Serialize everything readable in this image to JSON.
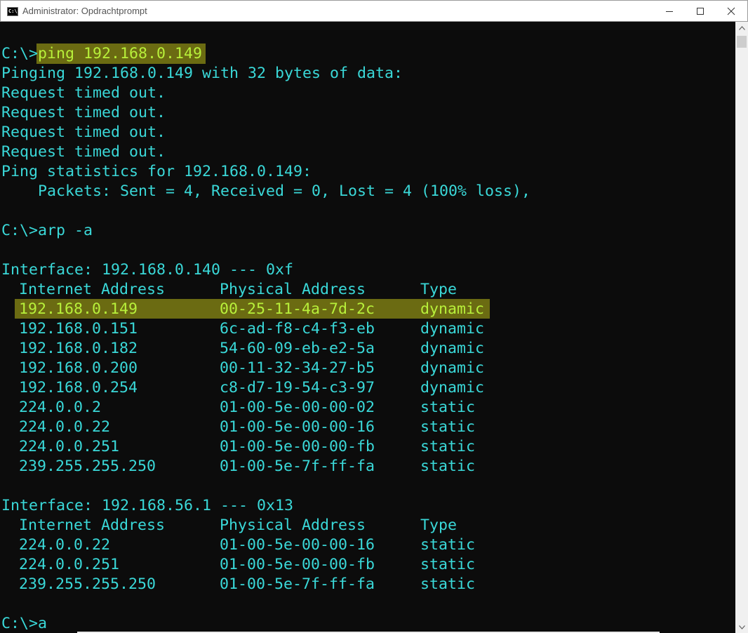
{
  "window": {
    "title": "Administrator: Opdrachtprompt",
    "icon": "cmd-icon",
    "icon_text": "C:\\"
  },
  "colors": {
    "text": "#3ad8d8",
    "highlight_bg": "#6b6b12",
    "highlight_text": "#b8f03a",
    "background": "#0c0c0c"
  },
  "console": {
    "ping_prompt": "C:\\>",
    "ping_command": "ping 192.168.0.149",
    "ping_output": [
      "Pinging 192.168.0.149 with 32 bytes of data:",
      "Request timed out.",
      "Request timed out.",
      "Request timed out.",
      "Request timed out.",
      "Ping statistics for 192.168.0.149:",
      "    Packets: Sent = 4, Received = 0, Lost = 4 (100% loss),"
    ],
    "arp_command": "C:\\>arp -a",
    "interfaces": [
      {
        "header": "Interface: 192.168.0.140 --- 0xf",
        "columns": [
          "Internet Address",
          "Physical Address",
          "Type"
        ],
        "rows": [
          {
            "ip": "192.168.0.149",
            "mac": "00-25-11-4a-7d-2c",
            "type": "dynamic"
          },
          {
            "ip": "192.168.0.151",
            "mac": "6c-ad-f8-c4-f3-eb",
            "type": "dynamic"
          },
          {
            "ip": "192.168.0.182",
            "mac": "54-60-09-eb-e2-5a",
            "type": "dynamic"
          },
          {
            "ip": "192.168.0.200",
            "mac": "00-11-32-34-27-b5",
            "type": "dynamic"
          },
          {
            "ip": "192.168.0.254",
            "mac": "c8-d7-19-54-c3-97",
            "type": "dynamic"
          },
          {
            "ip": "224.0.0.2",
            "mac": "01-00-5e-00-00-02",
            "type": "static"
          },
          {
            "ip": "224.0.0.22",
            "mac": "01-00-5e-00-00-16",
            "type": "static"
          },
          {
            "ip": "224.0.0.251",
            "mac": "01-00-5e-00-00-fb",
            "type": "static"
          },
          {
            "ip": "239.255.255.250",
            "mac": "01-00-5e-7f-ff-fa",
            "type": "static"
          }
        ]
      },
      {
        "header": "Interface: 192.168.56.1 --- 0x13",
        "columns": [
          "Internet Address",
          "Physical Address",
          "Type"
        ],
        "rows": [
          {
            "ip": "224.0.0.22",
            "mac": "01-00-5e-00-00-16",
            "type": "static"
          },
          {
            "ip": "224.0.0.251",
            "mac": "01-00-5e-00-00-fb",
            "type": "static"
          },
          {
            "ip": "239.255.255.250",
            "mac": "01-00-5e-7f-ff-fa",
            "type": "static"
          }
        ]
      }
    ],
    "current_input": "C:\\>a"
  },
  "titlebar_buttons": {
    "minimize": "minimize-icon",
    "maximize": "maximize-icon",
    "close": "close-icon"
  }
}
